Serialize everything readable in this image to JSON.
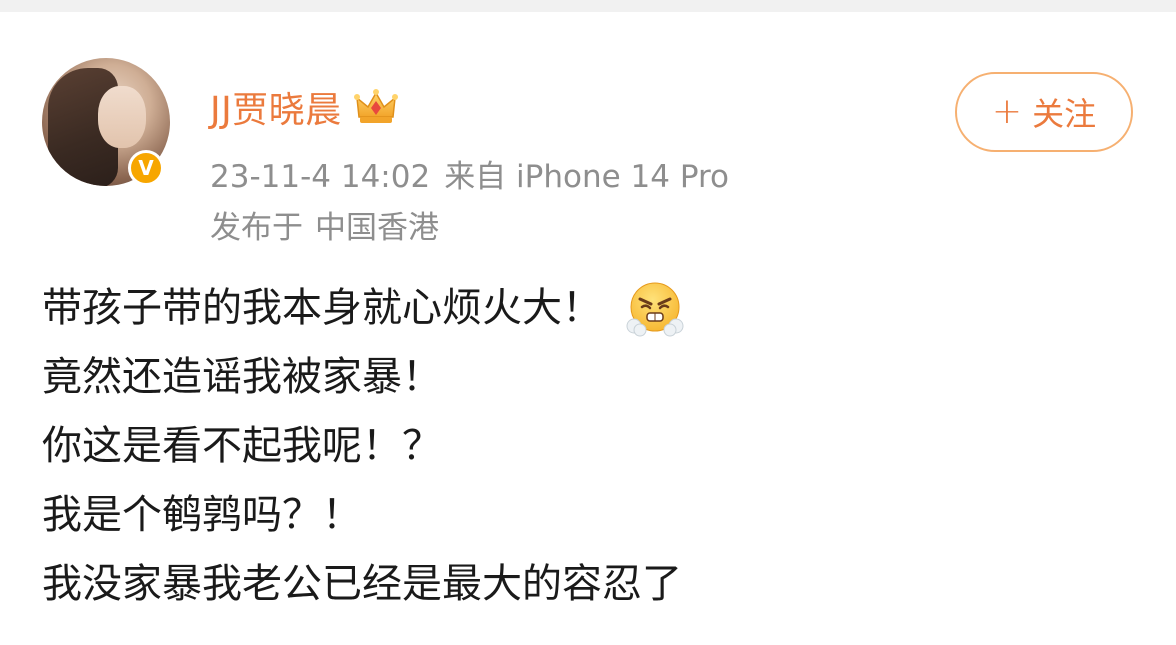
{
  "post": {
    "author": {
      "name": "JJ贾晓晨",
      "avatar_icon": "woman-portrait-avatar",
      "verified_badge_text": "V",
      "badge_icon": "crown-icon"
    },
    "meta": {
      "time": "23-11-4 14:02",
      "source": "来自 iPhone 14 Pro",
      "location_prefix": "发布于",
      "location": "中国香港"
    },
    "follow_button": {
      "plus": "+",
      "label": "关注"
    },
    "content_lines": [
      "带孩子带的我本身就心烦火大！",
      "竟然还造谣我被家暴！",
      "你这是看不起我呢！？",
      "我是个鹌鹑吗？！",
      "我没家暴我老公已经是最大的容忍了"
    ],
    "emoji": "angry-face-icon"
  },
  "colors": {
    "accent": "#eb7a3d",
    "button_border": "#f6b071",
    "meta_text": "#8e8e8e",
    "verified": "#f7a600",
    "text": "#1a1a1a"
  }
}
